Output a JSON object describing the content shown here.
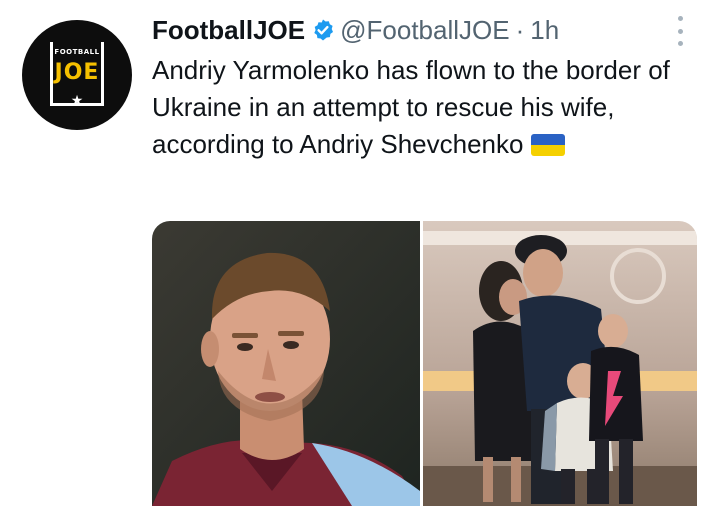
{
  "account": {
    "display_name": "FootballJOE",
    "handle": "@FootballJOE",
    "separator": "·",
    "time": "1h",
    "verified": true,
    "avatar_logo_small": "FOOTBALL",
    "avatar_logo_big": "JOE",
    "avatar_logo_star": "★"
  },
  "tweet": {
    "text": "Andriy Yarmolenko has flown to the border of Ukraine in an attempt to rescue his wife, according to Andriy Shevchenko",
    "emoji": "ukraine-flag-icon"
  },
  "media": {
    "photos": [
      "player-portrait-photo",
      "family-photo"
    ]
  },
  "icons": {
    "verified": "verified-badge-icon",
    "more": "more-options-icon"
  },
  "colors": {
    "text": "#0f1419",
    "secondary_text": "#536471",
    "verified_blue": "#1d9bf0",
    "avatar_bg": "#0d0d0d",
    "logo_yellow": "#f5c000",
    "flag_blue": "#2a62c4",
    "flag_yellow": "#f5d000"
  }
}
